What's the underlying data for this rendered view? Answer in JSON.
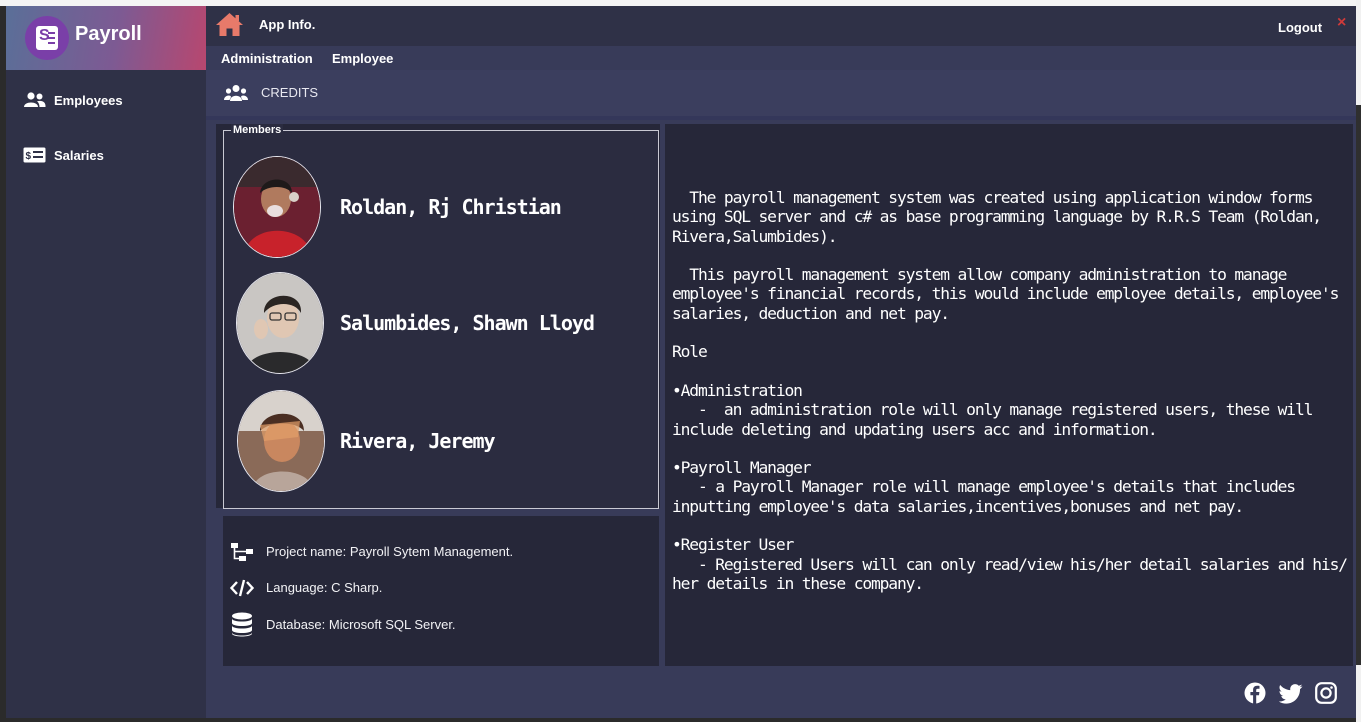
{
  "app": {
    "title": "Payroll"
  },
  "sidebar": {
    "items": [
      {
        "label": "Employees",
        "icon": "users-icon"
      },
      {
        "label": "Salaries",
        "icon": "money-card-icon"
      }
    ]
  },
  "header": {
    "app_info": "App Info.",
    "logout": "Logout",
    "close": "×"
  },
  "menubar": {
    "items": [
      "Administration",
      "Employee"
    ]
  },
  "page": {
    "title": "CREDITS"
  },
  "members": {
    "legend": "Members",
    "list": [
      "Roldan, Rj Christian",
      "Salumbides, Shawn Lloyd",
      "Rivera, Jeremy"
    ]
  },
  "project": {
    "name": "Project name: Payroll Sytem Management.",
    "language": "Language: C Sharp.",
    "database": "Database:  Microsoft SQL Server."
  },
  "description": "  The payroll management system was created using application window forms\nusing SQL server and c# as base programming language by R.R.S Team (Roldan,\nRivera,Salumbides).\n\n  This payroll management system allow company administration to manage\nemployee's financial records, this would include employee details, employee's\nsalaries, deduction and net pay.\n\nRole\n\n•Administration\n   -  an administration role will only manage registered users, these will\ninclude deleting and updating users acc and information.\n\n•Payroll Manager\n   - a Payroll Manager role will manage employee's details that includes\ninputting employee's data salaries,incentives,bonuses and net pay.\n\n•Register User\n   - Registered Users will can only read/view his/her detail salaries and his/\nher details in these company.",
  "social": [
    "facebook-icon",
    "twitter-icon",
    "instagram-icon"
  ],
  "colors": {
    "accent": "#e87a6a",
    "close": "#cf3a3a",
    "panel": "#262739",
    "background": "#383b59"
  }
}
